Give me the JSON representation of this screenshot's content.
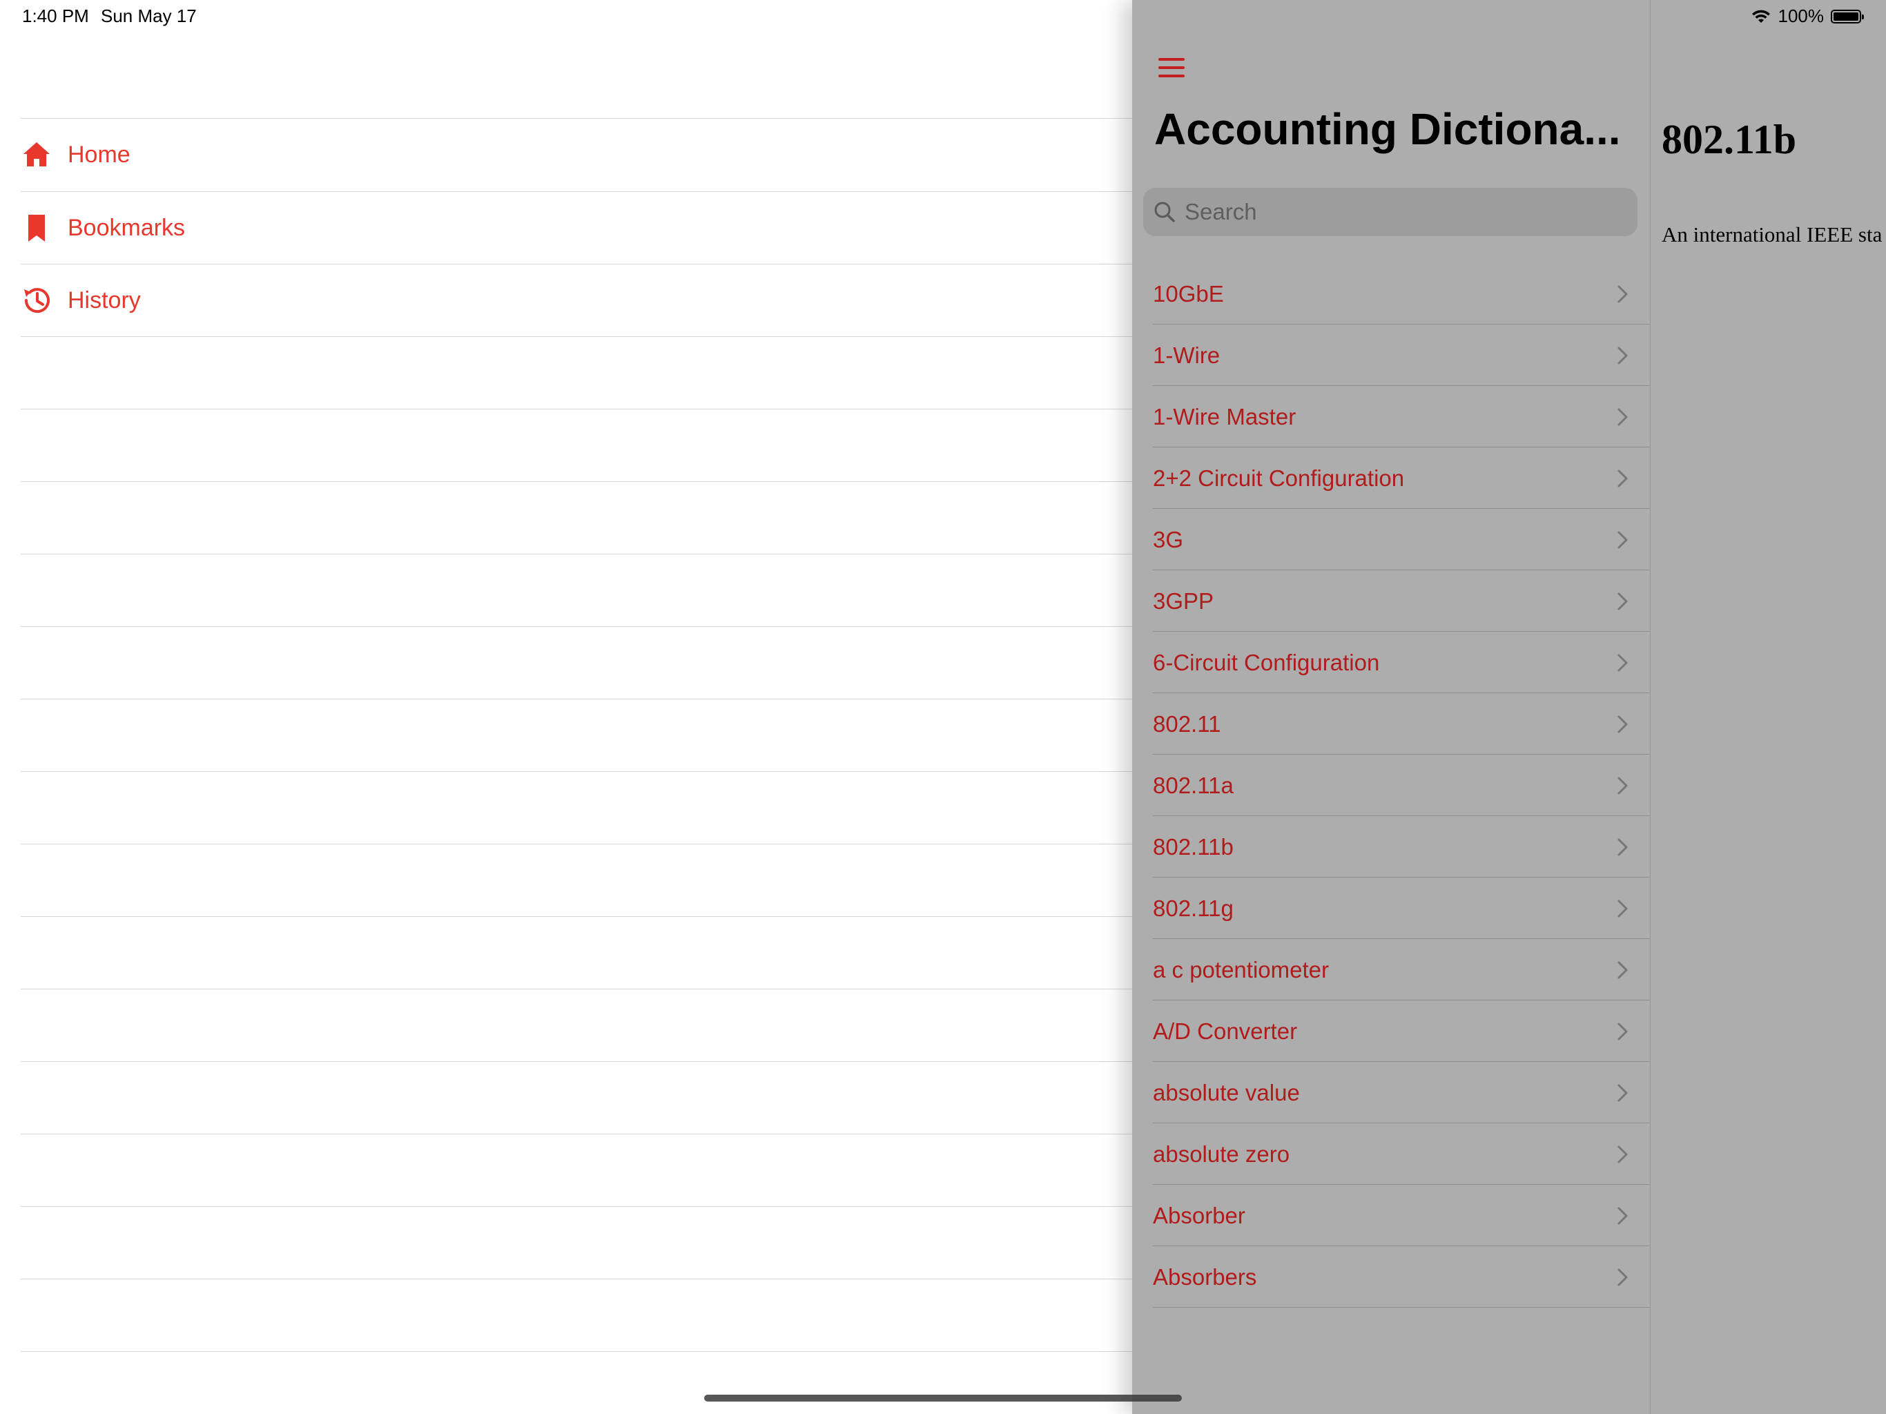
{
  "status_bar": {
    "time": "1:40 PM",
    "date": "Sun May 17",
    "battery": "100%"
  },
  "menu": {
    "items": [
      {
        "label": "Home",
        "icon": "house-icon"
      },
      {
        "label": "Bookmarks",
        "icon": "bookmark-icon"
      },
      {
        "label": "History",
        "icon": "history-icon"
      }
    ]
  },
  "list_pane": {
    "title": "Accounting Dictiona...",
    "search_placeholder": "Search",
    "entries": [
      "10GbE",
      "1-Wire",
      "1-Wire Master",
      "2+2 Circuit Configuration",
      "3G",
      "3GPP",
      "6-Circuit Configuration",
      "802.11",
      "802.11a",
      "802.11b",
      "802.11g",
      "a c potentiometer",
      "A/D Converter",
      "absolute value",
      "absolute zero",
      "Absorber",
      "Absorbers"
    ]
  },
  "detail": {
    "title": "802.11b",
    "body": "An international IEEE sta"
  },
  "colors": {
    "accent": "#e8382e",
    "entry_text": "#b01c1c",
    "pane_bg": "#adadad"
  }
}
